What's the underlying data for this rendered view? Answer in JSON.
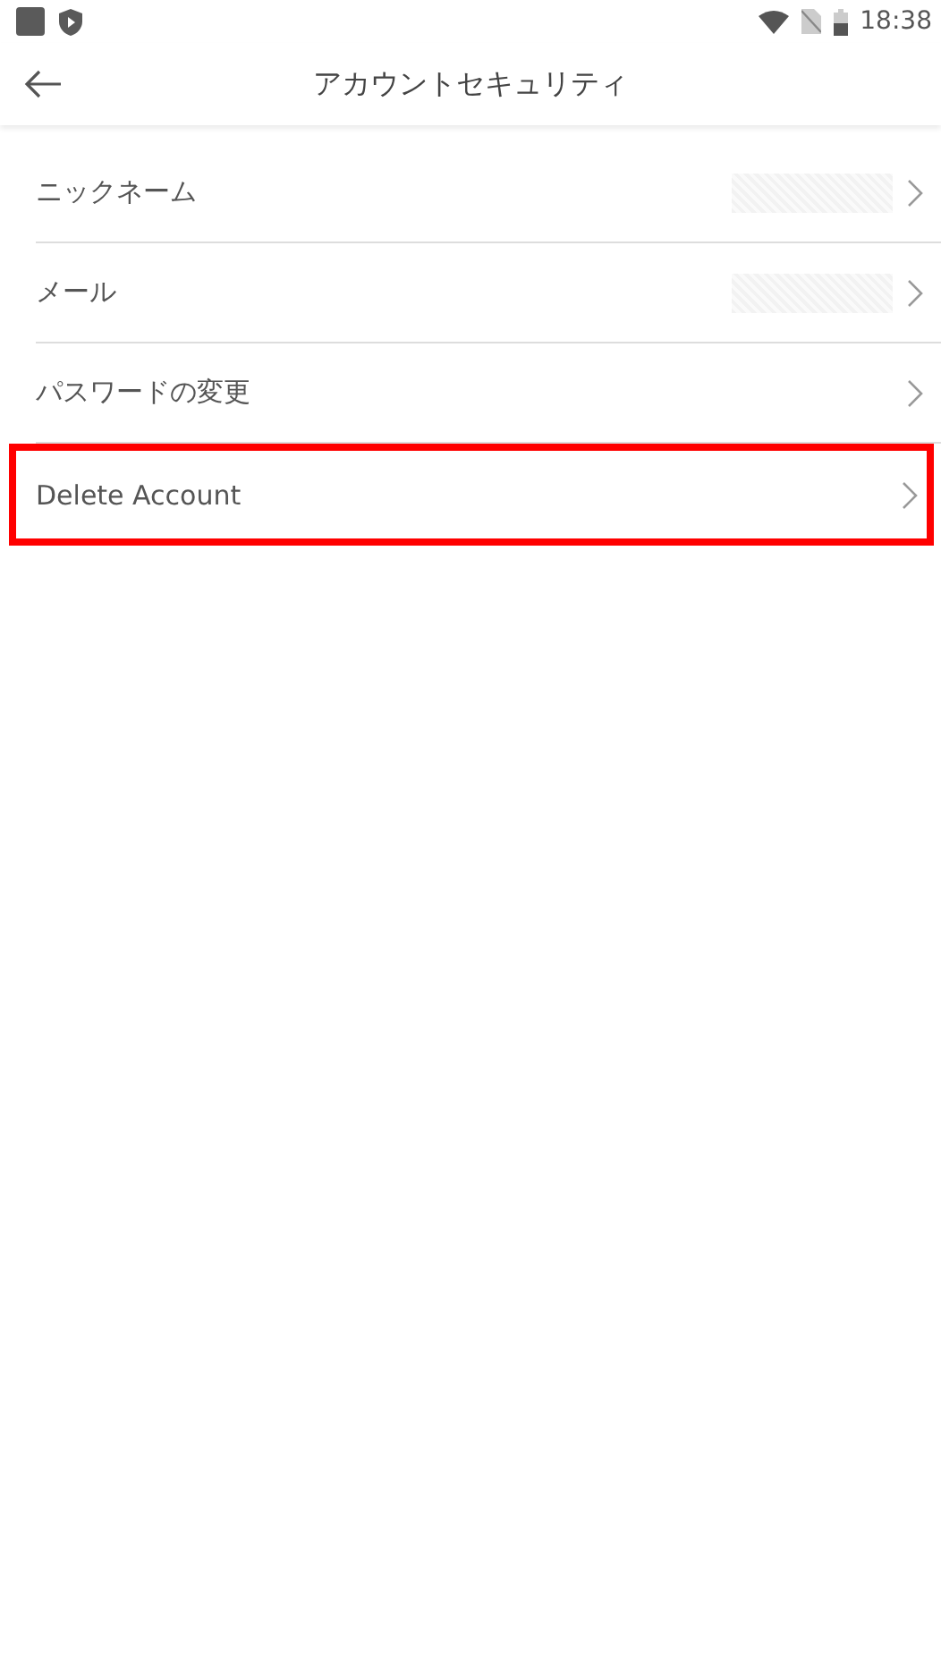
{
  "status_bar": {
    "time": "18:38"
  },
  "header": {
    "title": "アカウントセキュリティ"
  },
  "items": [
    {
      "label": "ニックネーム",
      "value_hidden": true,
      "highlighted": false
    },
    {
      "label": "メール",
      "value_hidden": true,
      "highlighted": false
    },
    {
      "label": "パスワードの変更",
      "value_hidden": false,
      "highlighted": false
    },
    {
      "label": "Delete Account",
      "value_hidden": false,
      "highlighted": true
    }
  ]
}
